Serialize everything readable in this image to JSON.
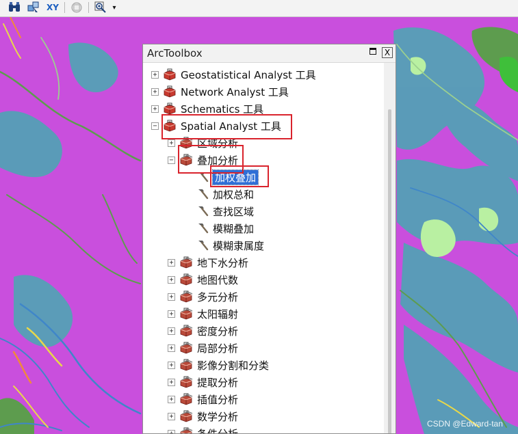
{
  "toolbar": {
    "icons": [
      "binoculars-icon",
      "select-features-icon",
      "go-to-xy-icon",
      "disabled-tool-icon",
      "zoom-window-icon",
      "toolbar-dropdown-icon"
    ],
    "xy_label": "XY"
  },
  "toolbox": {
    "title": "ArcToolbox",
    "maximize_icon": "maximize-icon",
    "close_label": "X",
    "items": [
      {
        "label": "Geostatistical Analyst 工具",
        "level": 0,
        "expander": "+",
        "icon": "toolbox-icon"
      },
      {
        "label": "Network Analyst 工具",
        "level": 0,
        "expander": "+",
        "icon": "toolbox-icon"
      },
      {
        "label": "Schematics 工具",
        "level": 0,
        "expander": "+",
        "icon": "toolbox-icon"
      },
      {
        "label": "Spatial Analyst 工具",
        "level": 0,
        "expander": "−",
        "icon": "toolbox-icon"
      },
      {
        "label": "区域分析",
        "level": 1,
        "expander": "+",
        "icon": "toolset-icon"
      },
      {
        "label": "叠加分析",
        "level": 1,
        "expander": "−",
        "icon": "toolset-icon"
      },
      {
        "label": "加权叠加",
        "level": 2,
        "icon": "hammer-icon",
        "selected": true
      },
      {
        "label": "加权总和",
        "level": 2,
        "icon": "hammer-icon"
      },
      {
        "label": "查找区域",
        "level": 2,
        "icon": "hammer-icon"
      },
      {
        "label": "模糊叠加",
        "level": 2,
        "icon": "hammer-icon"
      },
      {
        "label": "模糊隶属度",
        "level": 2,
        "icon": "hammer-icon"
      },
      {
        "label": "地下水分析",
        "level": 1,
        "expander": "+",
        "icon": "toolset-icon"
      },
      {
        "label": "地图代数",
        "level": 1,
        "expander": "+",
        "icon": "toolset-icon"
      },
      {
        "label": "多元分析",
        "level": 1,
        "expander": "+",
        "icon": "toolset-icon"
      },
      {
        "label": "太阳辐射",
        "level": 1,
        "expander": "+",
        "icon": "toolset-icon"
      },
      {
        "label": "密度分析",
        "level": 1,
        "expander": "+",
        "icon": "toolset-icon"
      },
      {
        "label": "局部分析",
        "level": 1,
        "expander": "+",
        "icon": "toolset-icon"
      },
      {
        "label": "影像分割和分类",
        "level": 1,
        "expander": "+",
        "icon": "toolset-icon"
      },
      {
        "label": "提取分析",
        "level": 1,
        "expander": "+",
        "icon": "toolset-icon"
      },
      {
        "label": "插值分析",
        "level": 1,
        "expander": "+",
        "icon": "toolset-icon"
      },
      {
        "label": "数学分析",
        "level": 1,
        "expander": "+",
        "icon": "toolset-icon"
      },
      {
        "label": "条件分析",
        "level": 1,
        "expander": "+",
        "icon": "toolset-icon"
      }
    ]
  },
  "map_colors": {
    "background": "#c94fdd",
    "teal": "#4fa4b4",
    "green": "#5d9c4e",
    "light_green": "#b9f0a2",
    "yellow": "#e8d84a",
    "orange": "#f08a3a"
  },
  "highlight_color": "#d9232c",
  "selection_color": "#2f6fd6",
  "watermark": "CSDN @Edward-tan"
}
